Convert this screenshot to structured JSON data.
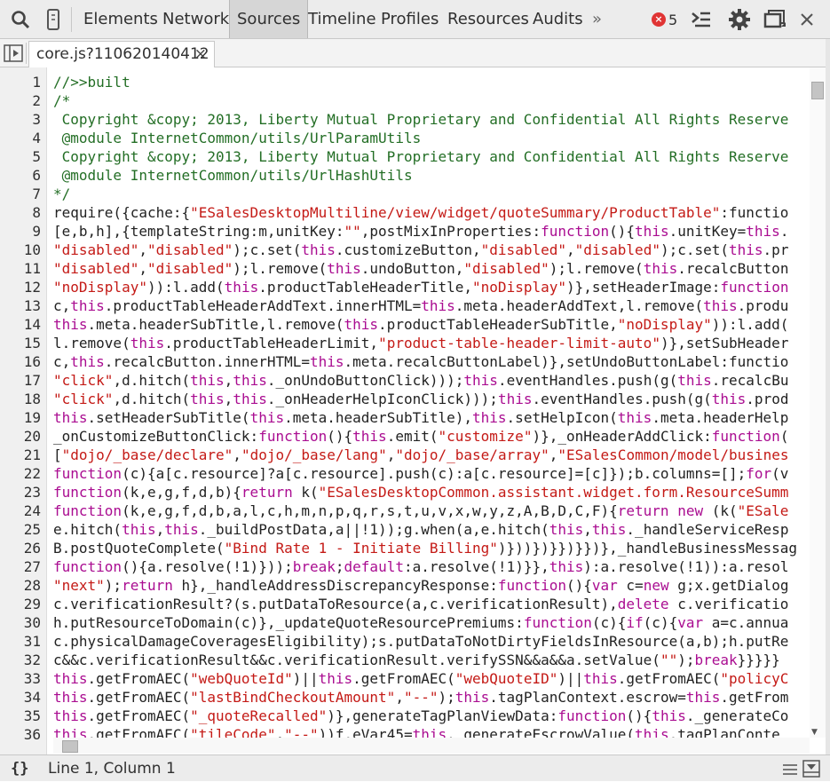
{
  "toolbar": {
    "tabs": [
      "Elements",
      "Network",
      "Sources",
      "Timeline",
      "Profiles",
      "Resources",
      "Audits"
    ],
    "active_tab": "Sources",
    "more": "»",
    "error_count": "5",
    "icons": [
      "search-icon",
      "device-mode-icon",
      "error-icon",
      "console-drawer-icon",
      "settings-gear-icon",
      "dock-icon",
      "close-icon"
    ]
  },
  "file_tab": {
    "name": "core.js?110620140412",
    "close": "×"
  },
  "editor": {
    "lines": [
      "//>>built",
      "/*",
      " Copyright &copy; 2013, Liberty Mutual Proprietary and Confidential All Rights Reserve",
      " @module InternetCommon/utils/UrlParamUtils",
      " Copyright &copy; 2013, Liberty Mutual Proprietary and Confidential All Rights Reserve",
      " @module InternetCommon/utils/UrlHashUtils",
      "*/",
      "require({cache:{\"ESalesDesktopMultiline/view/widget/quoteSummary/ProductTable\":functio",
      "[e,b,h],{templateString:m,unitKey:\"\",postMixInProperties:function(){this.unitKey=this.",
      "\"disabled\",\"disabled\");c.set(this.customizeButton,\"disabled\",\"disabled\");c.set(this.pr",
      "\"disabled\",\"disabled\");l.remove(this.undoButton,\"disabled\");l.remove(this.recalcButton",
      "\"noDisplay\")):l.add(this.productTableHeaderTitle,\"noDisplay\")},setHeaderImage:function",
      "c,this.productTableHeaderAddText.innerHTML=this.meta.headerAddText,l.remove(this.produ",
      "this.meta.headerSubTitle,l.remove(this.productTableHeaderSubTitle,\"noDisplay\")):l.add(",
      "l.remove(this.productTableHeaderLimit,\"product-table-header-limit-auto\")},setSubHeader",
      "c,this.recalcButton.innerHTML=this.meta.recalcButtonLabel)},setUndoButtonLabel:functio",
      "\"click\",d.hitch(this,this._onUndoButtonClick)));this.eventHandles.push(g(this.recalcBu",
      "\"click\",d.hitch(this,this._onHeaderHelpIconClick)));this.eventHandles.push(g(this.prod",
      "this.setHeaderSubTitle(this.meta.headerSubTitle),this.setHelpIcon(this.meta.headerHelp",
      "_onCustomizeButtonClick:function(){this.emit(\"customize\")},_onHeaderAddClick:function(",
      "[\"dojo/_base/declare\",\"dojo/_base/lang\",\"dojo/_base/array\",\"ESalesCommon/model/busines",
      "function(c){a[c.resource]?a[c.resource].push(c):a[c.resource]=[c]});b.columns=[];for(v",
      "function(k,e,g,f,d,b){return k(\"ESalesDesktopCommon.assistant.widget.form.ResourceSumm",
      "function(k,e,g,f,d,b,a,l,c,h,m,n,p,q,r,s,t,u,v,x,w,y,z,A,B,D,C,F){return new (k(\"ESale",
      "e.hitch(this,this._buildPostData,a||!1));g.when(a,e.hitch(this,this._handleServiceResp",
      "B.postQuoteComplete(\"Bind Rate 1 - Initiate Billing\")}))})}})}})},_handleBusinessMessag",
      "function(){a.resolve(!1)}));break;default:a.resolve(!1)}},this):a.resolve(!1)):a.resol",
      "\"next\");return h},_handleAddressDiscrepancyResponse:function(){var c=new g;x.getDialog",
      "c.verificationResult?(s.putDataToResource(a,c.verificationResult),delete c.verificatio",
      "h.putResourceToDomain(c)},_updateQuoteResourcePremiums:function(c){if(c){var a=c.annua",
      "c.physicalDamageCoveragesEligibility);s.putDataToNotDirtyFieldsInResource(a,b);h.putRe",
      "c&&c.verificationResult&&c.verificationResult.verifySSN&&a&&a.setValue(\"\");break}}}}}",
      "this.getFromAEC(\"webQuoteId\")||this.getFromAEC(\"webQuoteID\")||this.getFromAEC(\"policyC",
      "this.getFromAEC(\"lastBindCheckoutAmount\",\"--\");this.tagPlanContext.escrow=this.getFrom",
      "this.getFromAEC(\"_quoteRecalled\")},generateTagPlanViewData:function(){this._generateCo",
      "this.getFromAEC(\"tileCode\",\"--\"))f.eVar45=this._generateEscrowValue(this.tagPlanConte"
    ]
  },
  "status": {
    "position": "Line 1, Column 1"
  }
}
